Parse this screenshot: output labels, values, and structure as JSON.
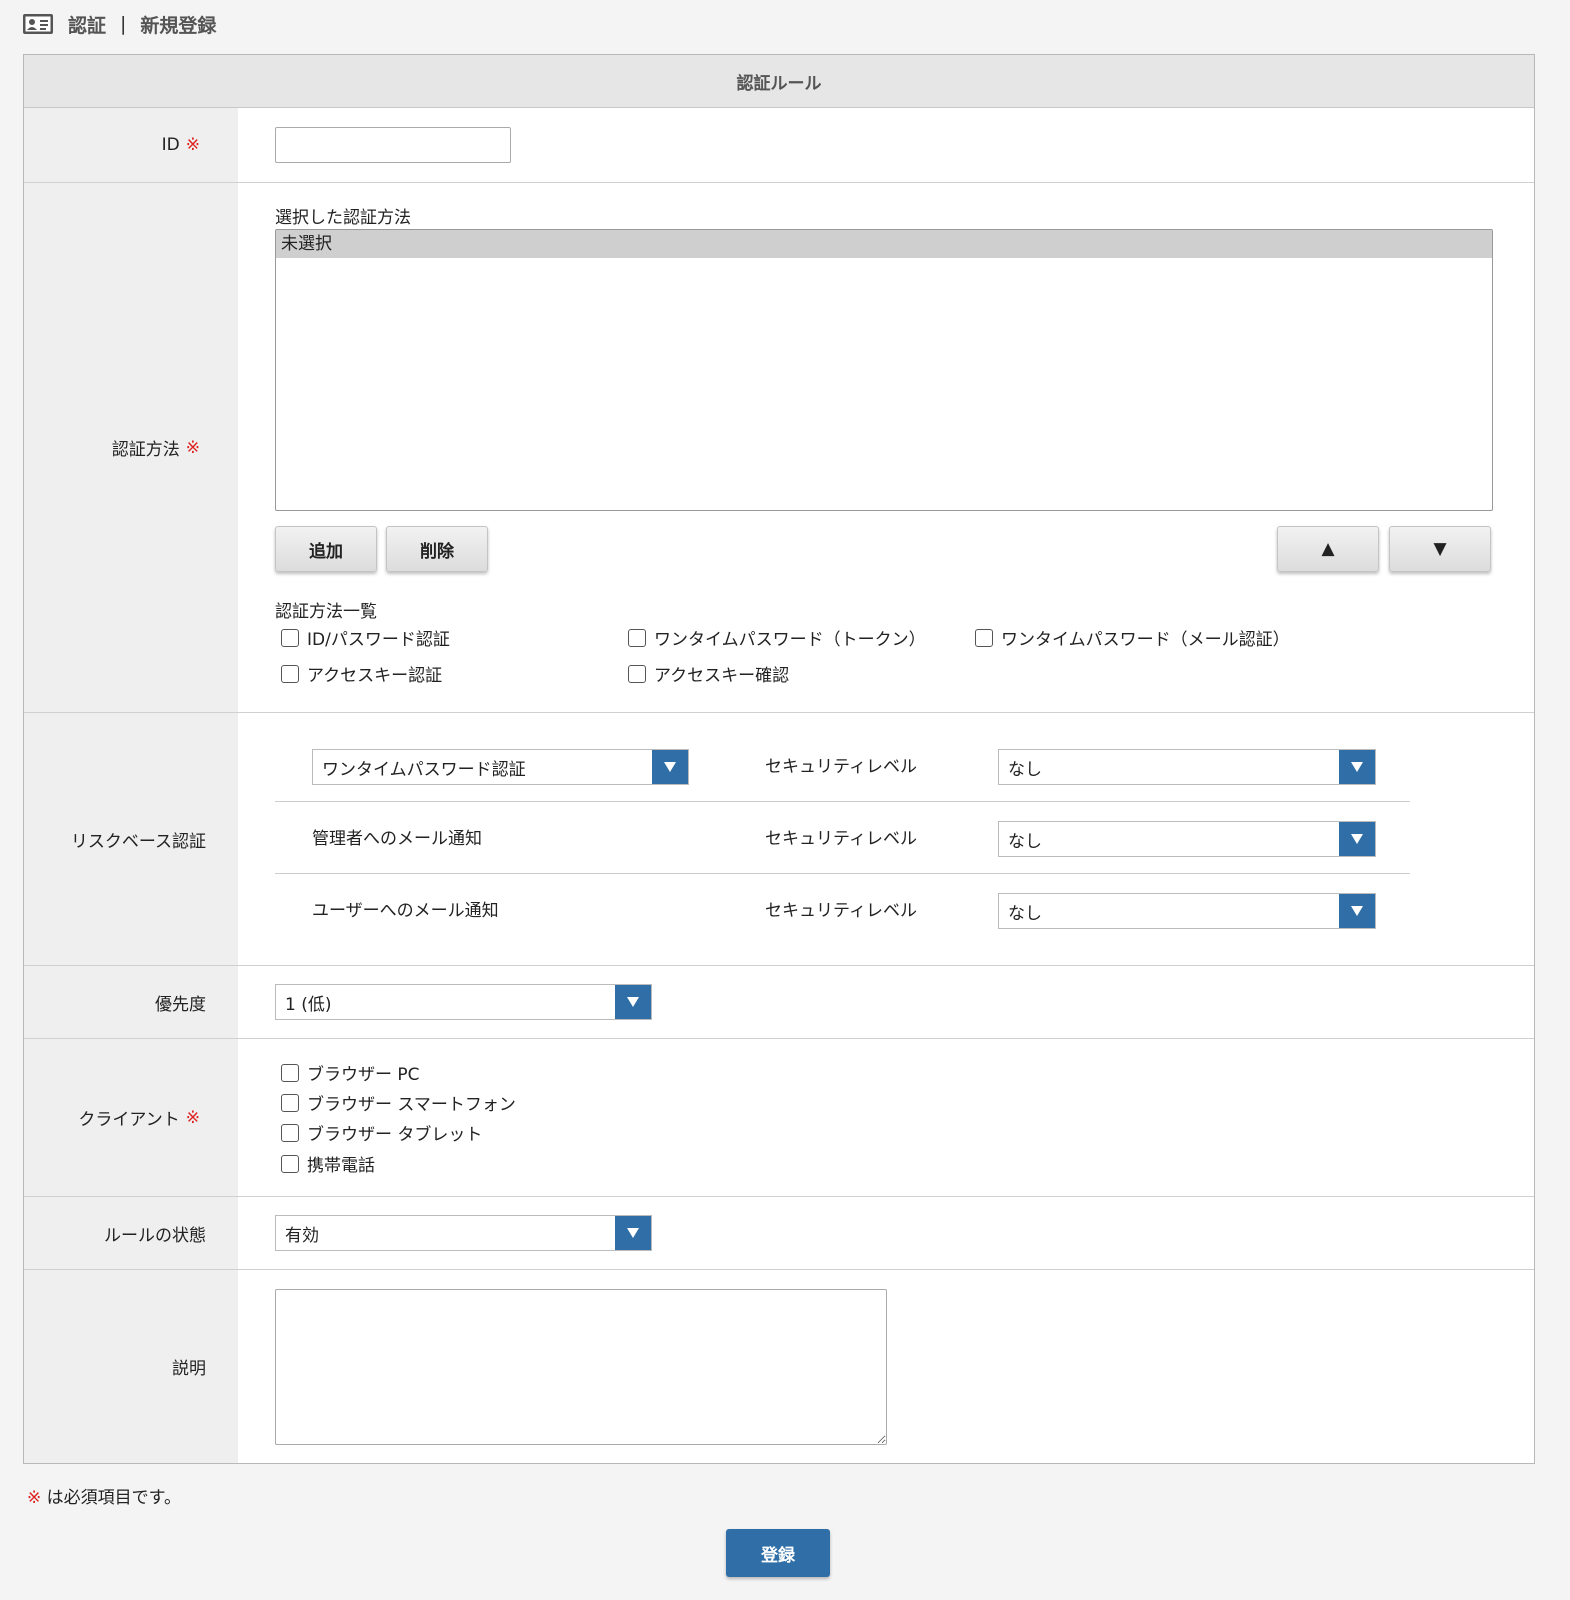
{
  "header": {
    "section": "認証",
    "separator": "|",
    "page": "新規登録"
  },
  "form": {
    "title": "認証ルール",
    "required_mark": "※",
    "id_row": {
      "label": "ID"
    },
    "method_row": {
      "label": "認証方法",
      "selected_label": "選択した認証方法",
      "selected_items": [
        "未選択"
      ],
      "add_button": "追加",
      "delete_button": "削除",
      "up_button": "▲",
      "down_button": "▼",
      "list_label": "認証方法一覧",
      "options": [
        "ID/パスワード認証",
        "ワンタイムパスワード（トークン）",
        "ワンタイムパスワード（メール認証）",
        "アクセスキー認証",
        "アクセスキー確認"
      ]
    },
    "risk_row": {
      "label": "リスクベース認証",
      "lines": [
        {
          "name": "ワンタイムパスワード認証",
          "level_label": "セキュリティレベル",
          "level": "なし"
        },
        {
          "name": "管理者へのメール通知",
          "level_label": "セキュリティレベル",
          "level": "なし"
        },
        {
          "name": "ユーザーへのメール通知",
          "level_label": "セキュリティレベル",
          "level": "なし"
        }
      ]
    },
    "priority_row": {
      "label": "優先度",
      "value": "1 (低)"
    },
    "client_row": {
      "label": "クライアント",
      "options": [
        "ブラウザー PC",
        "ブラウザー スマートフォン",
        "ブラウザー タブレット",
        "携帯電話"
      ]
    },
    "status_row": {
      "label": "ルールの状態",
      "value": "有効"
    },
    "desc_row": {
      "label": "説明"
    }
  },
  "footer": {
    "required_note": "は必須項目です。",
    "submit": "登録"
  },
  "colors": {
    "accent": "#2f6ea6",
    "required": "#dd2222"
  }
}
